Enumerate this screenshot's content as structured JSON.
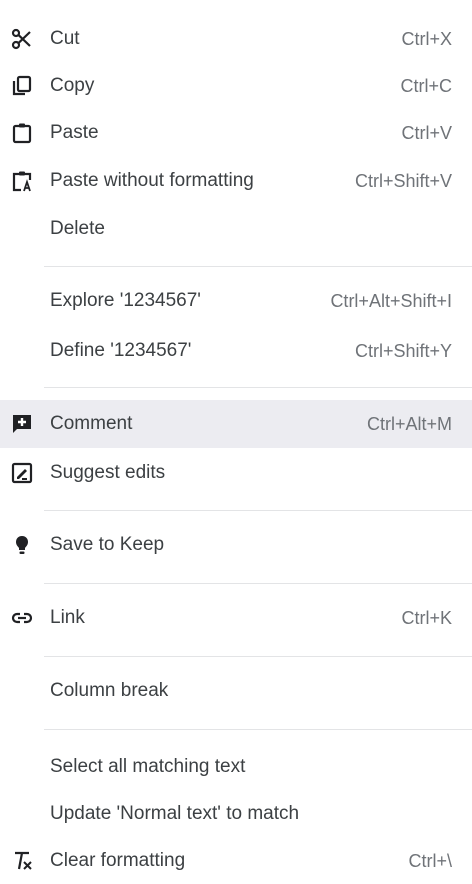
{
  "menu": {
    "cut": {
      "label": "Cut",
      "shortcut": "Ctrl+X",
      "icon": "scissors-icon"
    },
    "copy": {
      "label": "Copy",
      "shortcut": "Ctrl+C",
      "icon": "copy-icon"
    },
    "paste": {
      "label": "Paste",
      "shortcut": "Ctrl+V",
      "icon": "clipboard-icon"
    },
    "paste_plain": {
      "label": "Paste without formatting",
      "shortcut": "Ctrl+Shift+V",
      "icon": "paste-plain-icon"
    },
    "delete": {
      "label": "Delete"
    },
    "explore": {
      "label": "Explore '1234567'",
      "shortcut": "Ctrl+Alt+Shift+I"
    },
    "define": {
      "label": "Define '1234567'",
      "shortcut": "Ctrl+Shift+Y"
    },
    "comment": {
      "label": "Comment",
      "shortcut": "Ctrl+Alt+M",
      "icon": "add-comment-icon",
      "highlighted": true
    },
    "suggest": {
      "label": "Suggest edits",
      "icon": "suggest-edits-icon"
    },
    "keep": {
      "label": "Save to Keep",
      "icon": "lightbulb-icon"
    },
    "link": {
      "label": "Link",
      "shortcut": "Ctrl+K",
      "icon": "link-icon"
    },
    "column_break": {
      "label": "Column break"
    },
    "select_matching": {
      "label": "Select all matching text"
    },
    "update_normal": {
      "label": "Update 'Normal text' to match"
    },
    "clear_formatting": {
      "label": "Clear formatting",
      "shortcut": "Ctrl+\\",
      "icon": "clear-formatting-icon"
    }
  },
  "colors": {
    "highlight": "#ececf1",
    "text": "#3c4043",
    "shortcut": "#6f7378",
    "icon": "#202124"
  }
}
